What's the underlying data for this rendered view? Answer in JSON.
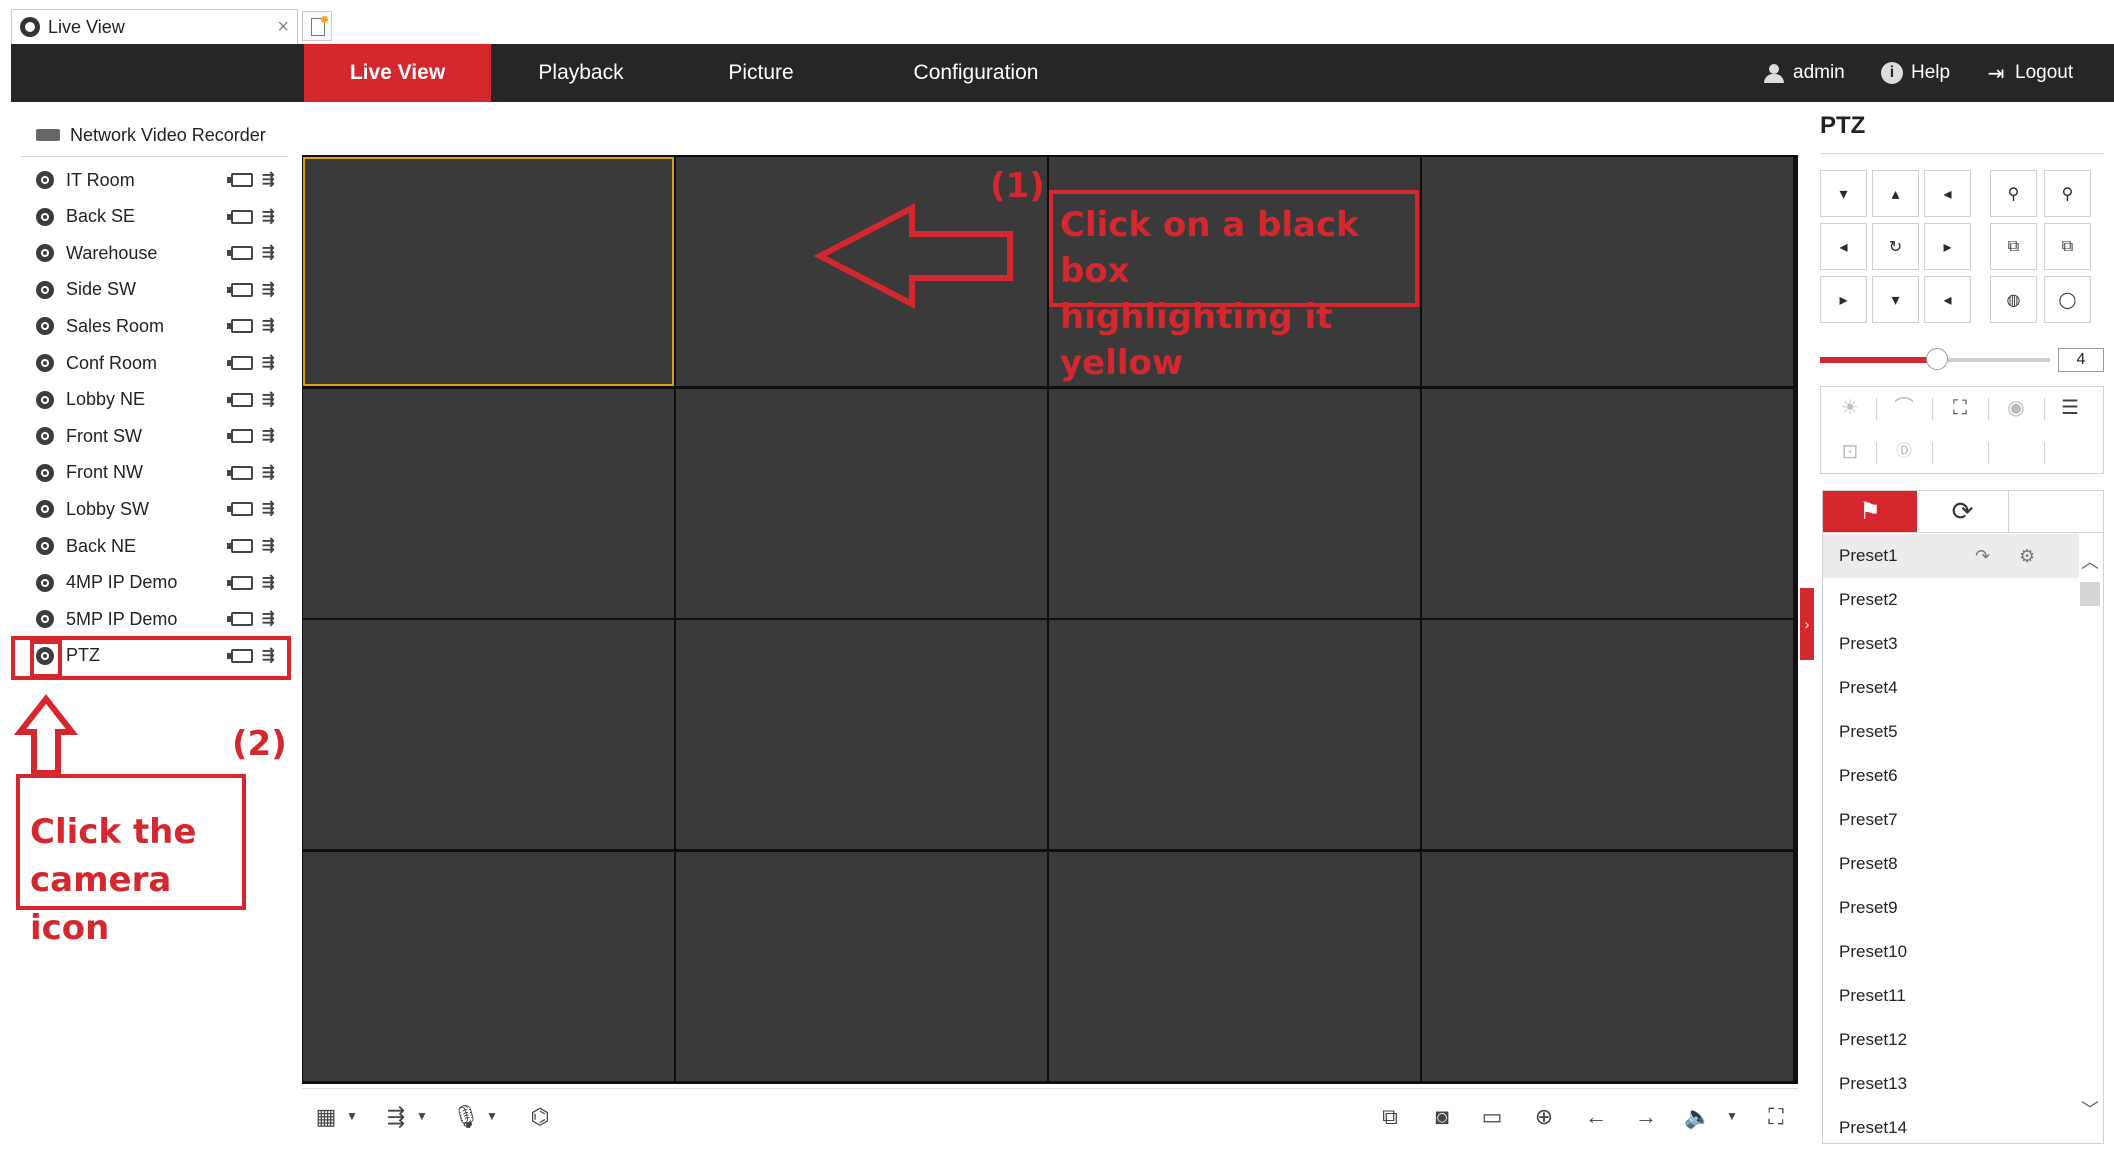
{
  "browser": {
    "tab_title": "Live View",
    "close_glyph": "×"
  },
  "nav": {
    "tabs": [
      "Live View",
      "Playback",
      "Picture",
      "Configuration"
    ],
    "user": "admin",
    "help": "Help",
    "logout": "Logout"
  },
  "tree": {
    "root": "Network Video Recorder",
    "cameras": [
      "IT Room",
      "Back SE",
      "Warehouse",
      "Side SW",
      "Sales Room",
      "Conf Room",
      "Lobby NE",
      "Front SW",
      "Front NW",
      "Lobby SW",
      "Back NE",
      "4MP IP Demo",
      "5MP IP Demo",
      "PTZ"
    ]
  },
  "video": {
    "selected_window": 1,
    "grid": "4x4"
  },
  "ptz": {
    "title": "PTZ",
    "speed": "4",
    "presets": [
      "Preset1",
      "Preset2",
      "Preset3",
      "Preset4",
      "Preset5",
      "Preset6",
      "Preset7",
      "Preset8",
      "Preset9",
      "Preset10",
      "Preset11",
      "Preset12",
      "Preset13",
      "Preset14"
    ]
  },
  "annotations": {
    "step1_num": "(1)",
    "step1_line1": "Click on a black box",
    "step1_line2": "highlighting it yellow",
    "step2_num": "(2)",
    "step2_line1": "Click the",
    "step2_line2": "camera icon"
  },
  "colors": {
    "accent": "#d5272e",
    "nav_bg": "#262626",
    "selected_border": "#d5a21c",
    "cell_bg": "#3a3a3a"
  }
}
